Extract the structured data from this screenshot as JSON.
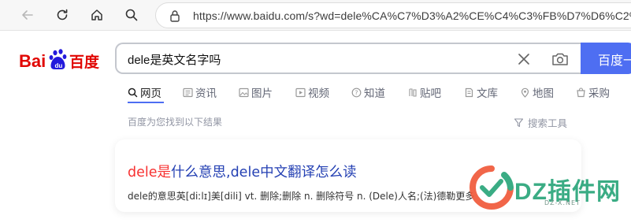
{
  "browser": {
    "url": "https://www.baidu.com/s?wd=dele%CA%C7%D3%A2%CE%C4%C3%FB%D7%D6%C2%F0"
  },
  "logo": {
    "text_left": "Bai",
    "text_right": "百度"
  },
  "search": {
    "query": "dele是英文名字吗",
    "button_label": "百度一下"
  },
  "tabs": [
    {
      "label": "网页",
      "icon": "search-icon"
    },
    {
      "label": "资讯",
      "icon": "news-icon"
    },
    {
      "label": "图片",
      "icon": "image-icon"
    },
    {
      "label": "视频",
      "icon": "video-icon"
    },
    {
      "label": "知道",
      "icon": "question-icon"
    },
    {
      "label": "贴吧",
      "icon": "tieba-icon"
    },
    {
      "label": "文库",
      "icon": "document-icon"
    },
    {
      "label": "地图",
      "icon": "map-icon"
    },
    {
      "label": "采购",
      "icon": "purchase-icon"
    }
  ],
  "results_info": {
    "count_text": "百度为您找到以下结果",
    "tools_label": "搜索工具"
  },
  "result": {
    "title_highlight": "dele是",
    "title_rest": "什么意思,dele中文翻译怎么读",
    "snippet": "dele的意思英[diːlɪ]美[dili] vt. 删除;删除 n. 删除符号 n. (Dele)人名;(法)德勒更多"
  },
  "watermark": {
    "brand": "DZ插件网",
    "sub": "DZ-X.NET"
  },
  "colors": {
    "accent": "#4e6ef2",
    "link": "#2440b3",
    "highlight": "#f73131",
    "logo_red": "#e10602",
    "logo_blue": "#2319dc"
  }
}
